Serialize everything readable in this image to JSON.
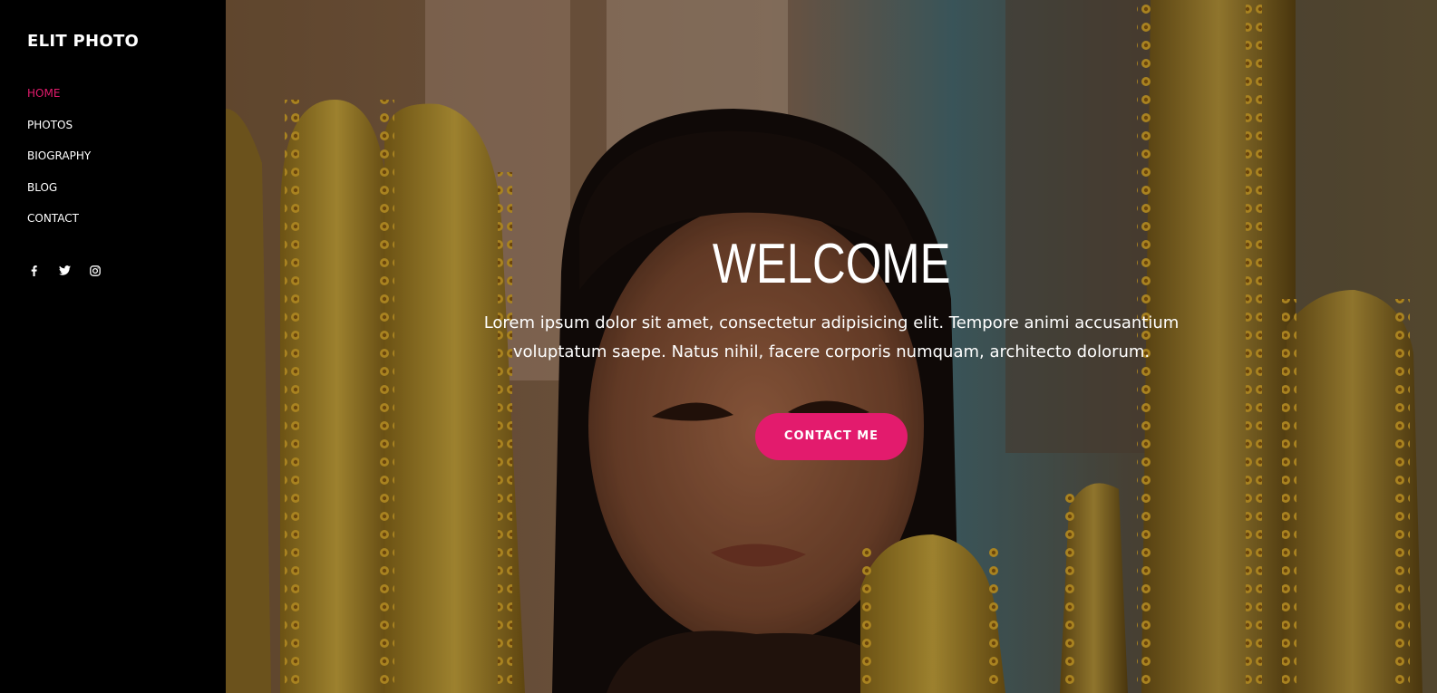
{
  "brand": {
    "name": "ELIT PHOTO"
  },
  "nav": {
    "items": [
      {
        "label": "HOME",
        "active": true
      },
      {
        "label": "PHOTOS",
        "active": false
      },
      {
        "label": "BIOGRAPHY",
        "active": false
      },
      {
        "label": "BLOG",
        "active": false
      },
      {
        "label": "CONTACT",
        "active": false
      }
    ]
  },
  "social": {
    "icons": [
      "facebook-icon",
      "twitter-icon",
      "instagram-icon"
    ]
  },
  "hero": {
    "title": "WELCOME",
    "text": "Lorem ipsum dolor sit amet, consectetur adipisicing elit. Tempore animi accusantium voluptatum saepe. Natus nihil, facere corporis numquam, architecto dolorum.",
    "cta_label": "CONTACT ME"
  },
  "colors": {
    "accent": "#e31b6d",
    "sidebar_bg": "#000000",
    "text": "#ffffff"
  }
}
